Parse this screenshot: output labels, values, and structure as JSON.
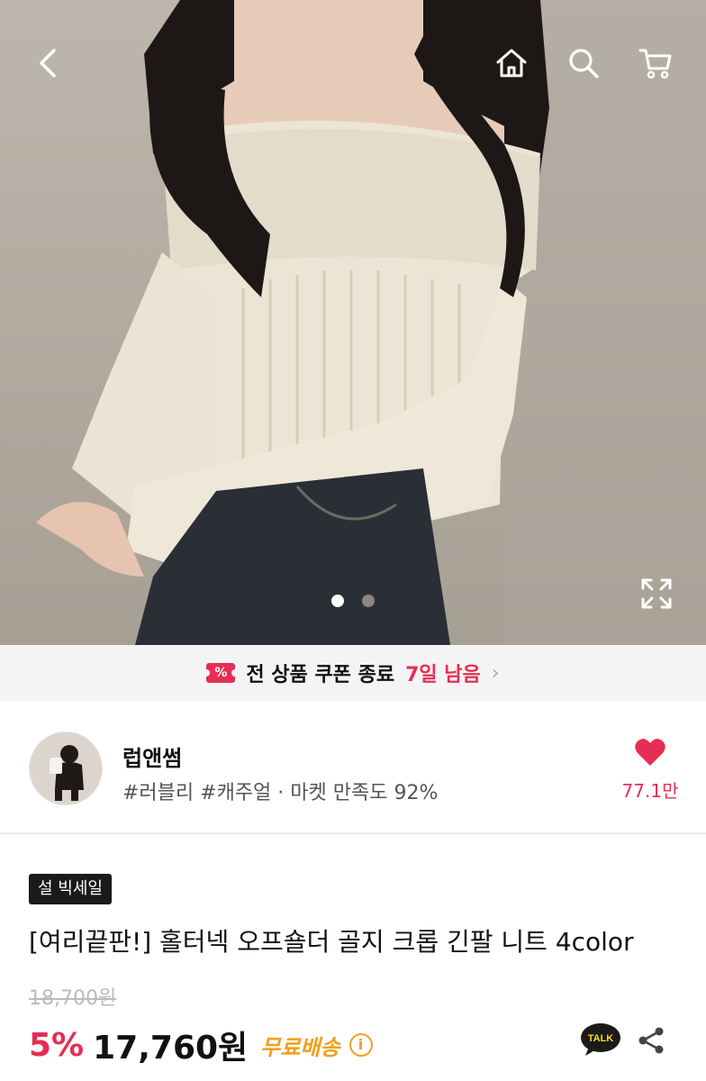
{
  "nav": {
    "back": "back-arrow-icon",
    "home": "home-icon",
    "search": "search-icon",
    "cart": "cart-icon"
  },
  "gallery": {
    "current_slide": 1,
    "total_slides": 2
  },
  "coupon": {
    "icon_label": "%",
    "text": "전 상품 쿠폰 종료",
    "highlight": "7일 남음",
    "chevron": "›"
  },
  "shop": {
    "name": "럽앤썸",
    "tags": "#러블리 #캐주얼 · 마켓 만족도 92%",
    "favorite_count": "77.1만"
  },
  "product": {
    "badge": "설 빅세일",
    "title": "[여리끝판!] 홀터넥 오프숄더 골지 크롭 긴팔 니트 4color",
    "original_price": "18,700원",
    "discount": "5%",
    "price": "17,760원",
    "shipping": "무료배송",
    "info_icon": "i",
    "talk_label": "TALK"
  },
  "colors": {
    "accent": "#e62e54",
    "shipping": "#f0a01b",
    "badge_bg": "#1a1a1a"
  }
}
